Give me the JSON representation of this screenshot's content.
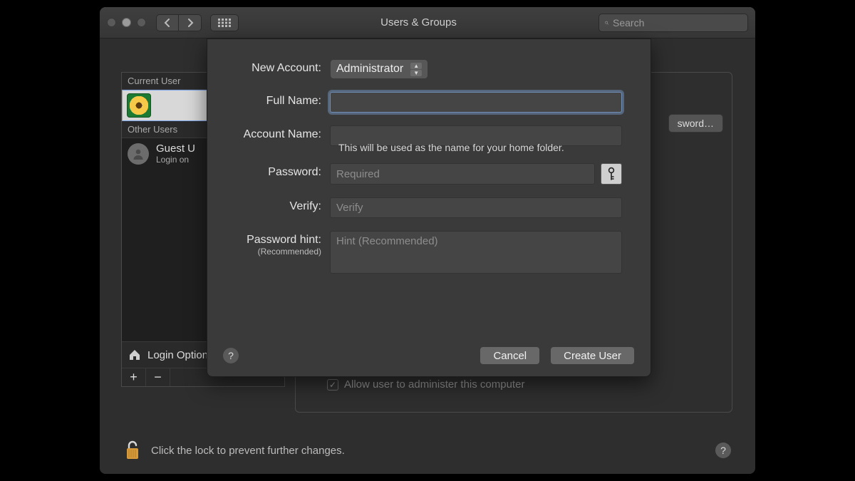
{
  "titlebar": {
    "title": "Users & Groups",
    "search_placeholder": "Search"
  },
  "sidebar": {
    "section_current": "Current User",
    "section_other": "Other Users",
    "guest_name": "Guest U",
    "guest_sub": "Login on",
    "login_options": "Login Options"
  },
  "main": {
    "change_password": "sword…",
    "admin_label": "Allow user to administer this computer"
  },
  "footer": {
    "lock_text": "Click the lock to prevent further changes."
  },
  "sheet": {
    "new_account_label": "New Account:",
    "account_type": "Administrator",
    "full_name_label": "Full Name:",
    "account_name_label": "Account Name:",
    "account_name_hint": "This will be used as the name for your home folder.",
    "password_label": "Password:",
    "password_placeholder": "Required",
    "verify_label": "Verify:",
    "verify_placeholder": "Verify",
    "hint_label": "Password hint:",
    "hint_sub": "(Recommended)",
    "hint_placeholder": "Hint (Recommended)",
    "cancel": "Cancel",
    "create": "Create User"
  }
}
